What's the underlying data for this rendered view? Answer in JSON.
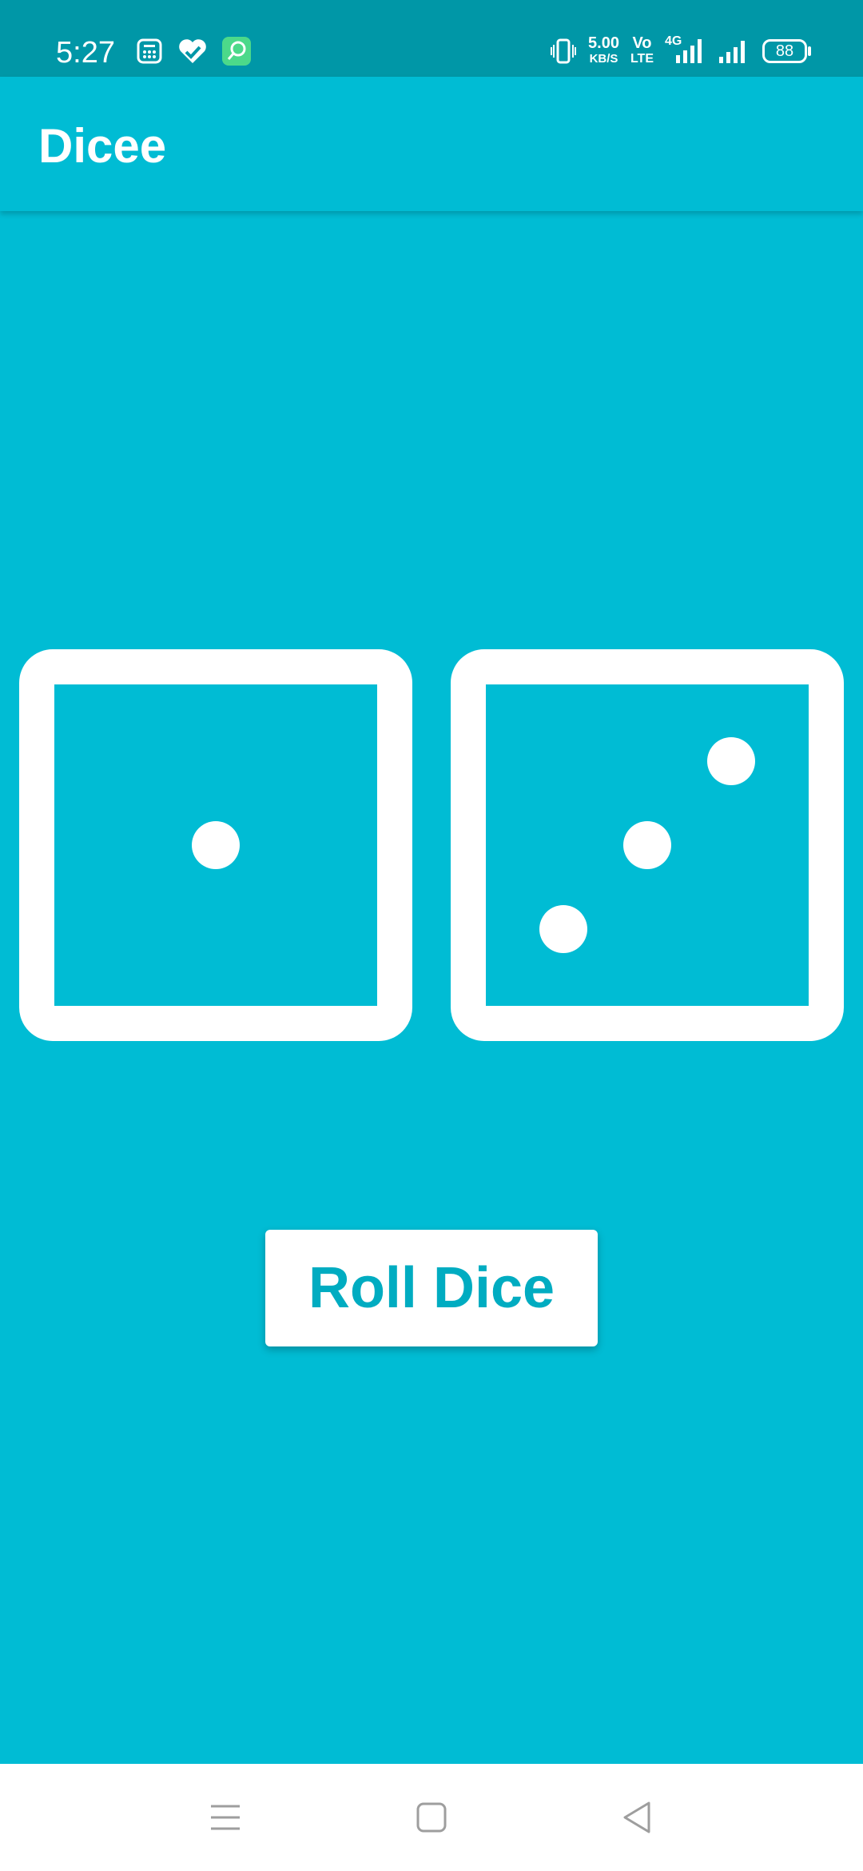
{
  "status_bar": {
    "time": "5:27",
    "net_speed_value": "5.00",
    "net_speed_unit": "KB/S",
    "volte_top": "Vo",
    "volte_bottom": "LTE",
    "network_type": "4G",
    "battery": "88",
    "icons": [
      "calculator-icon",
      "health-icon",
      "app-icon",
      "vibrate-icon",
      "signal-icon",
      "signal-icon-2",
      "battery-icon"
    ]
  },
  "app_bar": {
    "title": "Dicee"
  },
  "dice": {
    "left_value": 1,
    "right_value": 3
  },
  "roll_button": {
    "label": "Roll Dice"
  },
  "nav_bar": {
    "icons": [
      "menu-icon",
      "home-icon",
      "back-icon"
    ]
  },
  "colors": {
    "background": "#00BCD4",
    "status_bar": "#0097A7",
    "die_color": "#FFFFFF",
    "button_text": "#00ACC1",
    "nav_bar": "#FFFFFF"
  }
}
